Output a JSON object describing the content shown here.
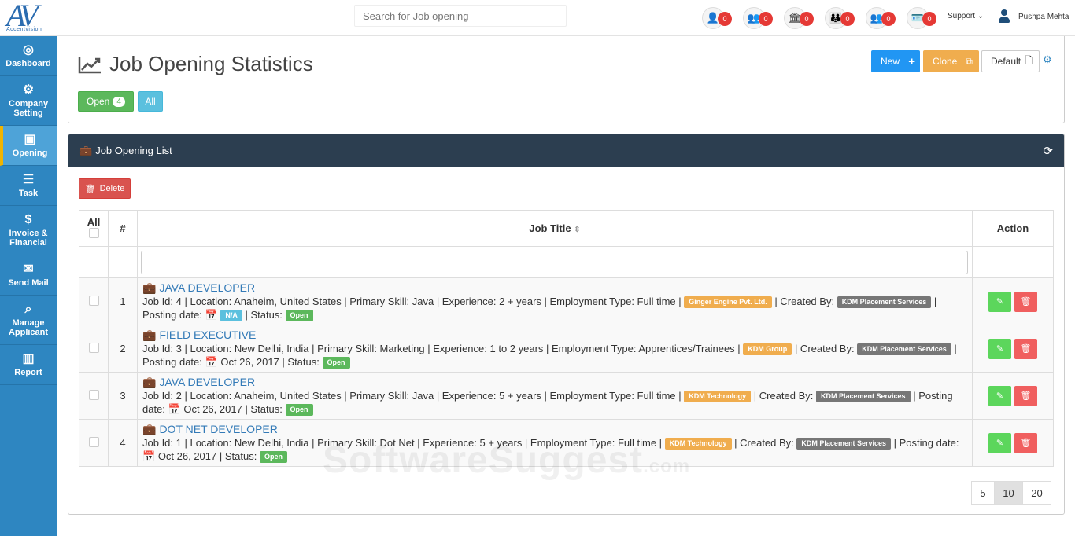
{
  "brand": {
    "logo_text": "AV",
    "tagline": "Accentvision"
  },
  "search": {
    "placeholder": "Search for Job opening"
  },
  "topbar": {
    "icons": [
      {
        "name": "person-icon",
        "glyph": "👤",
        "count": "0"
      },
      {
        "name": "group-icon",
        "glyph": "👥",
        "count": "0"
      },
      {
        "name": "bank-icon",
        "glyph": "🏛",
        "count": "0"
      },
      {
        "name": "meeting-icon",
        "glyph": "👪",
        "count": "0"
      },
      {
        "name": "users-icon",
        "glyph": "👥",
        "count": "0"
      },
      {
        "name": "id-card-icon",
        "glyph": "🪪",
        "count": "0"
      }
    ],
    "support_label": "Support",
    "user_name": "Pushpa Mehta"
  },
  "sidebar": {
    "items": [
      {
        "label": "Dashboard",
        "icon": "dashboard-icon",
        "glyph": "◎"
      },
      {
        "label": "Company Setting",
        "icon": "gear-icon",
        "glyph": "⚙"
      },
      {
        "label": "Opening",
        "icon": "opening-icon",
        "glyph": "▣"
      },
      {
        "label": "Task",
        "icon": "task-icon",
        "glyph": "☰"
      },
      {
        "label": "Invoice & Financial",
        "icon": "invoice-icon",
        "glyph": "$"
      },
      {
        "label": "Send Mail",
        "icon": "mail-icon",
        "glyph": "✉"
      },
      {
        "label": "Manage Applicant",
        "icon": "applicant-icon",
        "glyph": "⌕"
      },
      {
        "label": "Report",
        "icon": "report-icon",
        "glyph": "▥"
      }
    ]
  },
  "header": {
    "title": "Job Opening Statistics",
    "open_label": "Open",
    "open_count": "4",
    "all_label": "All",
    "new_label": "New",
    "clone_label": "Clone",
    "default_label": "Default"
  },
  "list": {
    "title": "Job Opening List",
    "delete_label": "Delete",
    "columns": {
      "all": "All",
      "num": "#",
      "title": "Job Title",
      "action": "Action"
    },
    "rows": [
      {
        "num": "1",
        "title": "JAVA DEVELOPER",
        "details": "Job Id: 4 | Location: Anaheim, United States | Primary Skill: Java | Experience: 2 + years | Employment Type: Full time |",
        "company": "Ginger Engine Pvt. Ltd.",
        "created_by_label": "| Created By:",
        "created_by": "KDM Placement Services",
        "posting_label": "| Posting date:",
        "posting_date": "N/A",
        "status_label": "| Status:",
        "status": "Open"
      },
      {
        "num": "2",
        "title": "FIELD EXECUTIVE",
        "details": "Job Id: 3 | Location: New Delhi, India | Primary Skill: Marketing | Experience: 1 to 2 years | Employment Type: Apprentices/Trainees |",
        "company": "KDM Group",
        "created_by_label": "| Created By:",
        "created_by": "KDM Placement Services",
        "posting_label": "| Posting date:",
        "posting_date": "Oct 26, 2017",
        "status_label": "| Status:",
        "status": "Open"
      },
      {
        "num": "3",
        "title": "JAVA DEVELOPER",
        "details": "Job Id: 2 | Location: Anaheim, United States | Primary Skill: Java | Experience: 5 + years | Employment Type: Full time |",
        "company": "KDM Technology",
        "created_by_label": "| Created By:",
        "created_by": "KDM Placement Services",
        "posting_label": "| Posting date:",
        "posting_date": "Oct 26, 2017",
        "status_label": "| Status:",
        "status": "Open"
      },
      {
        "num": "4",
        "title": "DOT NET DEVELOPER",
        "details": "Job Id: 1 | Location: New Delhi, India | Primary Skill: Dot Net | Experience: 5 + years | Employment Type: Full time |",
        "company": "KDM Technology",
        "created_by_label": "| Created By:",
        "created_by": "KDM Placement Services",
        "posting_label": "| Posting date:",
        "posting_date": "Oct 26, 2017",
        "status_label": "| Status:",
        "status": "Open"
      }
    ]
  },
  "pagination": {
    "sizes": [
      "5",
      "10",
      "20"
    ],
    "active": "10"
  },
  "watermark": {
    "main": "SoftwareSuggest",
    "suffix": ".com"
  },
  "colors": {
    "sidebar": "#2e86c1",
    "list_header": "#2c3e50",
    "open": "#5cb85c",
    "new": "#2196f3",
    "clone": "#f0ad4e",
    "delete": "#d9534f"
  }
}
